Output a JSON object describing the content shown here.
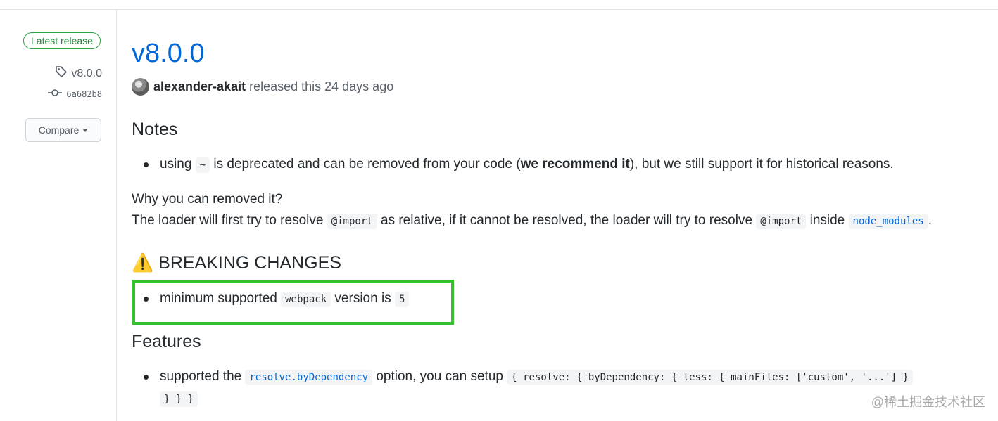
{
  "sidebar": {
    "badge": "Latest release",
    "tag": "v8.0.0",
    "commit": "6a682b8",
    "compare_label": "Compare"
  },
  "release": {
    "title": "v8.0.0",
    "author": "alexander-akait",
    "released_text": "released this 24 days ago"
  },
  "notes": {
    "heading": "Notes",
    "bullet_prefix": "using",
    "bullet_code": "~",
    "bullet_mid": "is deprecated and can be removed from your code (",
    "bullet_bold": "we recommend it",
    "bullet_suffix": "), but we still support it for historical reasons.",
    "why_line": "Why you can removed it?",
    "loader_prefix": "The loader will first try to resolve",
    "loader_code1": "@import",
    "loader_mid": "as relative, if it cannot be resolved, the loader will try to resolve",
    "loader_code2": "@import",
    "loader_inside": "inside",
    "loader_code3": "node_modules",
    "loader_end": "."
  },
  "breaking": {
    "icon": "⚠️",
    "heading": "BREAKING CHANGES",
    "bullet_prefix": "minimum supported",
    "bullet_code": "webpack",
    "bullet_mid": "version is",
    "bullet_code2": "5"
  },
  "features": {
    "heading": "Features",
    "bullet_prefix": "supported the",
    "bullet_code": "resolve.byDependency",
    "bullet_mid": "option, you can setup",
    "bullet_code2": "{ resolve: { byDependency: { less: { mainFiles: ['custom', '...'] }",
    "bullet_code3": "} } }"
  },
  "watermark": "@稀土掘金技术社区",
  "colors": {
    "link": "#0366d6",
    "badge_green": "#28a745",
    "highlight_green": "#35c12c"
  }
}
